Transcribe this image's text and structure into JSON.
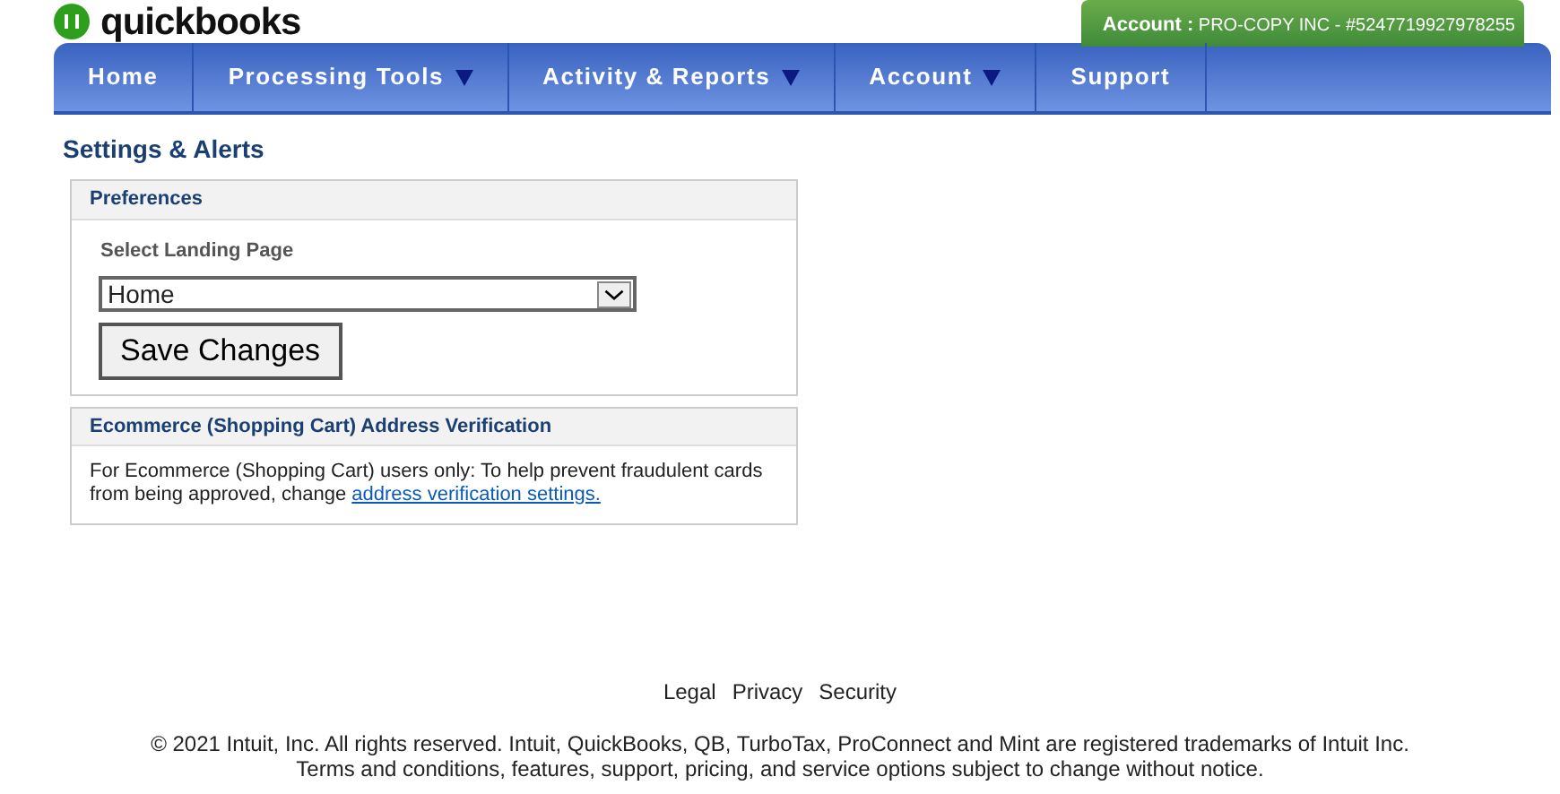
{
  "logo": {
    "text": "quickbooks"
  },
  "account_tab": {
    "label": "Account :",
    "value": "PRO-COPY INC - #5247719927978255"
  },
  "nav": [
    {
      "label": "Home",
      "dropdown": false
    },
    {
      "label": "Processing Tools",
      "dropdown": true
    },
    {
      "label": "Activity & Reports",
      "dropdown": true
    },
    {
      "label": "Account",
      "dropdown": true
    },
    {
      "label": "Support",
      "dropdown": false
    }
  ],
  "page_title": "Settings & Alerts",
  "preferences": {
    "title": "Preferences",
    "field_label": "Select Landing Page",
    "select_value": "Home",
    "button": "Save Changes"
  },
  "ecommerce": {
    "title": "Ecommerce (Shopping Cart) Address Verification",
    "text": "For Ecommerce (Shopping Cart) users only: To help prevent fraudulent cards from being approved, change",
    "link": "address verification settings."
  },
  "footer": {
    "links": [
      "Legal",
      "Privacy",
      "Security"
    ],
    "lines": [
      "© 2021 Intuit, Inc. All rights reserved. Intuit, QuickBooks, QB, TurboTax, ProConnect and Mint are registered trademarks of Intuit Inc.",
      "Terms and conditions, features, support, pricing, and service options subject to change without notice."
    ]
  }
}
